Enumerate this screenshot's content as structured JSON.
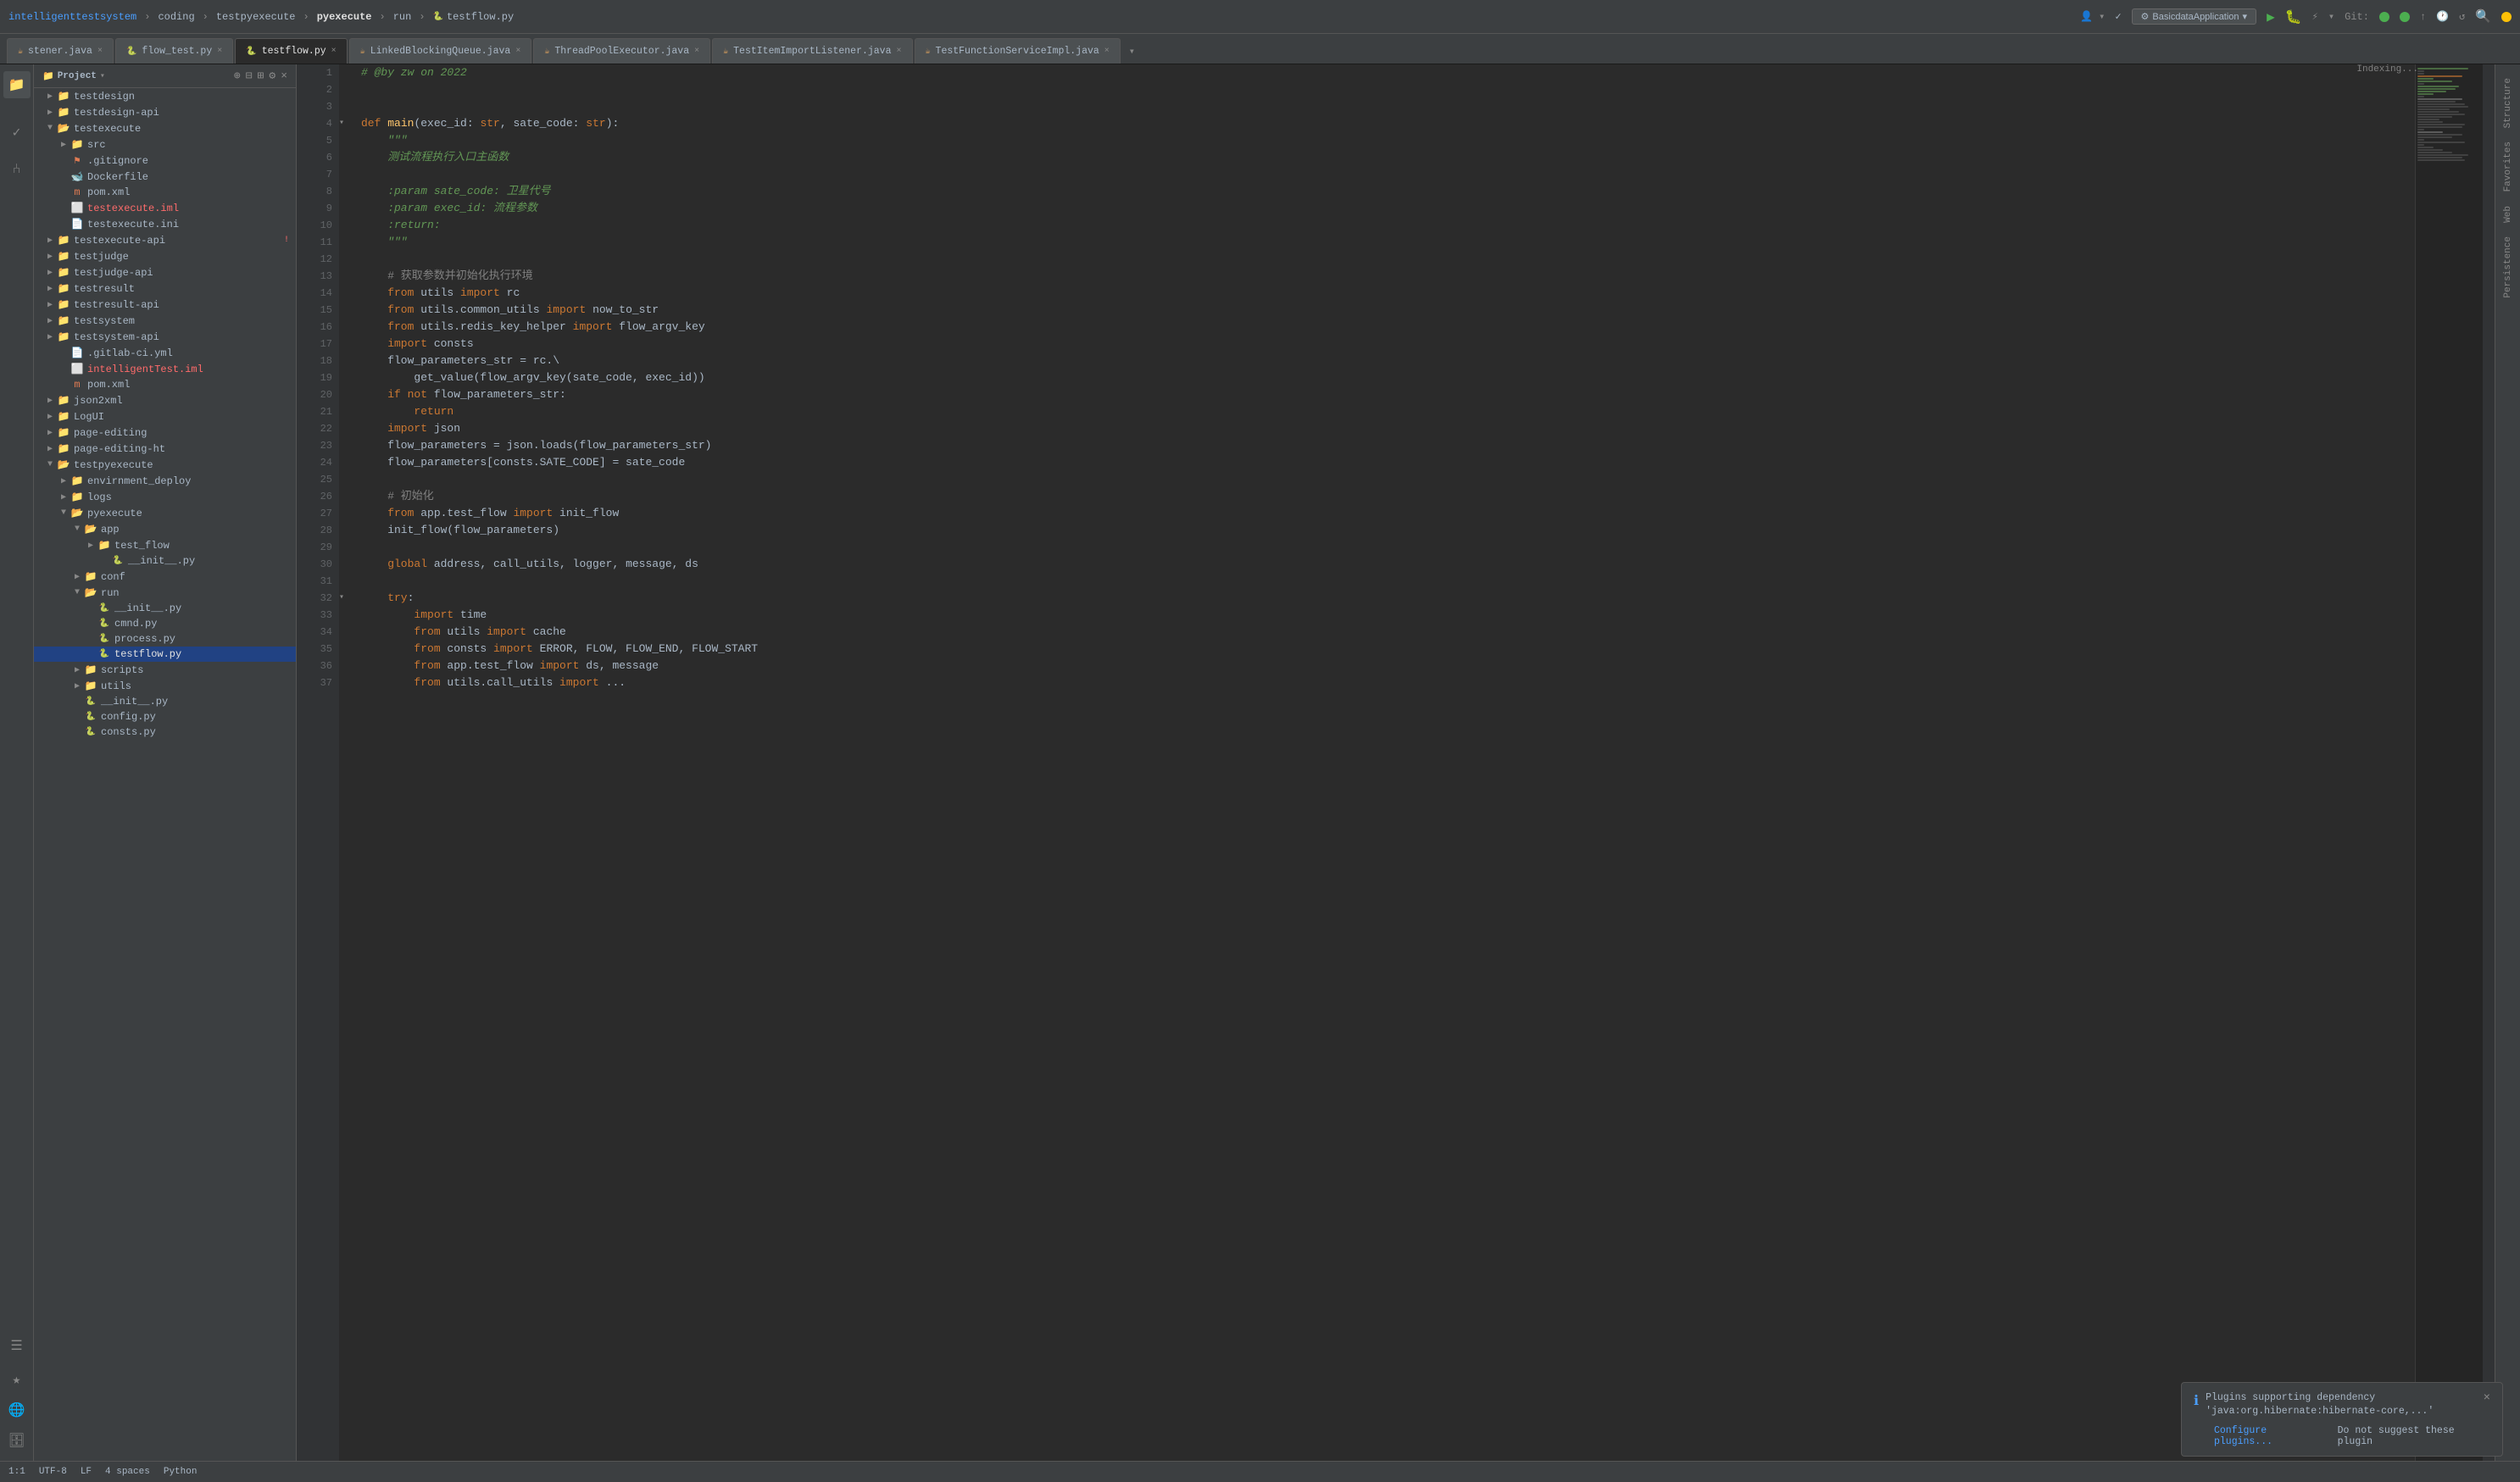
{
  "topbar": {
    "breadcrumb": [
      "intelligenttestsystem",
      "coding",
      "testpyexecute",
      "pyexecute",
      "run"
    ],
    "file": "testflow.py",
    "run_config": "BasicdataApplication",
    "git_label": "Git:"
  },
  "tabs": [
    {
      "id": "tab1",
      "label": "stener.java",
      "type": "java",
      "active": false,
      "closable": true
    },
    {
      "id": "tab2",
      "label": "flow_test.py",
      "type": "py",
      "active": false,
      "closable": true
    },
    {
      "id": "tab3",
      "label": "testflow.py",
      "type": "py",
      "active": true,
      "closable": true
    },
    {
      "id": "tab4",
      "label": "LinkedBlockingQueue.java",
      "type": "java",
      "active": false,
      "closable": true
    },
    {
      "id": "tab5",
      "label": "ThreadPoolExecutor.java",
      "type": "java",
      "active": false,
      "closable": true
    },
    {
      "id": "tab6",
      "label": "TestItemImportListener.java",
      "type": "java",
      "active": false,
      "closable": true
    },
    {
      "id": "tab7",
      "label": "TestFunctionServiceImpl.java",
      "type": "java",
      "active": false,
      "closable": true
    }
  ],
  "tree": {
    "title": "Project",
    "items": [
      {
        "level": 0,
        "type": "folder",
        "name": "testdesign",
        "expanded": false
      },
      {
        "level": 0,
        "type": "folder",
        "name": "testdesign-api",
        "expanded": false
      },
      {
        "level": 0,
        "type": "folder",
        "name": "testexecute",
        "expanded": true
      },
      {
        "level": 1,
        "type": "folder",
        "name": "src",
        "expanded": false
      },
      {
        "level": 1,
        "type": "file",
        "name": ".gitignore",
        "filetype": "git"
      },
      {
        "level": 1,
        "type": "file",
        "name": "Dockerfile",
        "filetype": "docker"
      },
      {
        "level": 1,
        "type": "file",
        "name": "pom.xml",
        "filetype": "xml"
      },
      {
        "level": 1,
        "type": "file",
        "name": "testexecute.iml",
        "filetype": "iml",
        "error": true
      },
      {
        "level": 1,
        "type": "file",
        "name": "testexecute.ini",
        "filetype": "ini"
      },
      {
        "level": 0,
        "type": "folder",
        "name": "testexecute-api",
        "expanded": false,
        "error": true
      },
      {
        "level": 0,
        "type": "folder",
        "name": "testjudge",
        "expanded": false
      },
      {
        "level": 0,
        "type": "folder",
        "name": "testjudge-api",
        "expanded": false
      },
      {
        "level": 0,
        "type": "folder",
        "name": "testresult",
        "expanded": false
      },
      {
        "level": 0,
        "type": "folder",
        "name": "testresult-api",
        "expanded": false
      },
      {
        "level": 0,
        "type": "folder",
        "name": "testsystem",
        "expanded": false
      },
      {
        "level": 0,
        "type": "folder",
        "name": "testsystem-api",
        "expanded": false
      },
      {
        "level": 1,
        "type": "file",
        "name": ".gitlab-ci.yml",
        "filetype": "yml"
      },
      {
        "level": 1,
        "type": "file",
        "name": "intelligentTest.iml",
        "filetype": "iml",
        "error": true
      },
      {
        "level": 1,
        "type": "file",
        "name": "pom.xml",
        "filetype": "xml"
      },
      {
        "level": 0,
        "type": "folder",
        "name": "json2xml",
        "expanded": false
      },
      {
        "level": 0,
        "type": "folder",
        "name": "LogUI",
        "expanded": false
      },
      {
        "level": 0,
        "type": "folder",
        "name": "page-editing",
        "expanded": false
      },
      {
        "level": 0,
        "type": "folder",
        "name": "page-editing-ht",
        "expanded": false
      },
      {
        "level": 0,
        "type": "folder",
        "name": "testpyexecute",
        "expanded": true
      },
      {
        "level": 1,
        "type": "folder",
        "name": "envirnment_deploy",
        "expanded": false
      },
      {
        "level": 1,
        "type": "folder",
        "name": "logs",
        "expanded": false
      },
      {
        "level": 1,
        "type": "folder",
        "name": "pyexecute",
        "expanded": true
      },
      {
        "level": 2,
        "type": "folder",
        "name": "app",
        "expanded": true
      },
      {
        "level": 3,
        "type": "folder",
        "name": "test_flow",
        "expanded": false
      },
      {
        "level": 4,
        "type": "file",
        "name": "__init__.py",
        "filetype": "py"
      },
      {
        "level": 2,
        "type": "folder",
        "name": "conf",
        "expanded": false
      },
      {
        "level": 2,
        "type": "folder",
        "name": "run",
        "expanded": true
      },
      {
        "level": 3,
        "type": "file",
        "name": "__init__.py",
        "filetype": "py"
      },
      {
        "level": 3,
        "type": "file",
        "name": "cmnd.py",
        "filetype": "py"
      },
      {
        "level": 3,
        "type": "file",
        "name": "process.py",
        "filetype": "py"
      },
      {
        "level": 3,
        "type": "file",
        "name": "testflow.py",
        "filetype": "py",
        "selected": true
      },
      {
        "level": 2,
        "type": "folder",
        "name": "scripts",
        "expanded": false
      },
      {
        "level": 2,
        "type": "folder",
        "name": "utils",
        "expanded": false
      },
      {
        "level": 2,
        "type": "file",
        "name": "__init__.py",
        "filetype": "py"
      },
      {
        "level": 2,
        "type": "file",
        "name": "config.py",
        "filetype": "py"
      },
      {
        "level": 2,
        "type": "file",
        "name": "consts.py",
        "filetype": "py"
      }
    ]
  },
  "editor": {
    "filename": "testflow.py",
    "indexing": "Indexing...",
    "lines": [
      {
        "num": 1,
        "content": "# @by zw on 2022",
        "type": "comment"
      },
      {
        "num": 2,
        "content": "",
        "type": "empty"
      },
      {
        "num": 3,
        "content": "",
        "type": "empty"
      },
      {
        "num": 4,
        "content": "def main(exec_id: str, sate_code: str):",
        "type": "def",
        "foldable": true
      },
      {
        "num": 5,
        "content": "    \"\"\"",
        "type": "docstring"
      },
      {
        "num": 6,
        "content": "    测试流程执行入口主函数",
        "type": "docstring-zh"
      },
      {
        "num": 7,
        "content": "",
        "type": "empty"
      },
      {
        "num": 8,
        "content": "    :param sate_code: 卫星代号",
        "type": "docstring-param"
      },
      {
        "num": 9,
        "content": "    :param exec_id: 流程参数",
        "type": "docstring-param"
      },
      {
        "num": 10,
        "content": "    :return:",
        "type": "docstring-param"
      },
      {
        "num": 11,
        "content": "    \"\"\"",
        "type": "docstring"
      },
      {
        "num": 12,
        "content": "",
        "type": "empty"
      },
      {
        "num": 13,
        "content": "    # 获取参数并初始化执行环境",
        "type": "comment-inline"
      },
      {
        "num": 14,
        "content": "    from utils import rc",
        "type": "import"
      },
      {
        "num": 15,
        "content": "    from utils.common_utils import now_to_str",
        "type": "import"
      },
      {
        "num": 16,
        "content": "    from utils.redis_key_helper import flow_argv_key",
        "type": "import"
      },
      {
        "num": 17,
        "content": "    import consts",
        "type": "import"
      },
      {
        "num": 18,
        "content": "    flow_parameters_str = rc.\\",
        "type": "code"
      },
      {
        "num": 19,
        "content": "        get_value(flow_argv_key(sate_code, exec_id))",
        "type": "code"
      },
      {
        "num": 20,
        "content": "    if not flow_parameters_str:",
        "type": "code"
      },
      {
        "num": 21,
        "content": "        return",
        "type": "code"
      },
      {
        "num": 22,
        "content": "    import json",
        "type": "import"
      },
      {
        "num": 23,
        "content": "    flow_parameters = json.loads(flow_parameters_str)",
        "type": "code"
      },
      {
        "num": 24,
        "content": "    flow_parameters[consts.SATE_CODE] = sate_code",
        "type": "code"
      },
      {
        "num": 25,
        "content": "",
        "type": "empty"
      },
      {
        "num": 26,
        "content": "    # 初始化",
        "type": "comment-inline"
      },
      {
        "num": 27,
        "content": "    from app.test_flow import init_flow",
        "type": "import"
      },
      {
        "num": 28,
        "content": "    init_flow(flow_parameters)",
        "type": "code"
      },
      {
        "num": 29,
        "content": "",
        "type": "empty"
      },
      {
        "num": 30,
        "content": "    global address, call_utils, logger, message, ds",
        "type": "code"
      },
      {
        "num": 31,
        "content": "",
        "type": "empty"
      },
      {
        "num": 32,
        "content": "    try:",
        "type": "code",
        "foldable": true
      },
      {
        "num": 33,
        "content": "        import time",
        "type": "import"
      },
      {
        "num": 34,
        "content": "        from utils import cache",
        "type": "import"
      },
      {
        "num": 35,
        "content": "        from consts import ERROR, FLOW, FLOW_END, FLOW_START",
        "type": "import"
      },
      {
        "num": 36,
        "content": "        from app.test_flow import ds, message",
        "type": "import"
      },
      {
        "num": 37,
        "content": "        from utils.call_utils import ...",
        "type": "import"
      }
    ]
  },
  "notification": {
    "text": "Plugins supporting dependency 'java:org.hibernate:hibernate-core,...'",
    "configure_link": "Configure plugins...",
    "dismiss_link": "Do not suggest these plugin"
  },
  "statusbar": {
    "line_col": "1:1",
    "encoding": "UTF-8",
    "line_ending": "LF",
    "indent": "4 spaces",
    "file_type": "Python"
  },
  "sidebar_labels": [
    "Structure",
    "Favorites",
    "Web",
    "Persistence"
  ],
  "left_icons": [
    "folder",
    "commit",
    "vcs",
    "settings"
  ]
}
